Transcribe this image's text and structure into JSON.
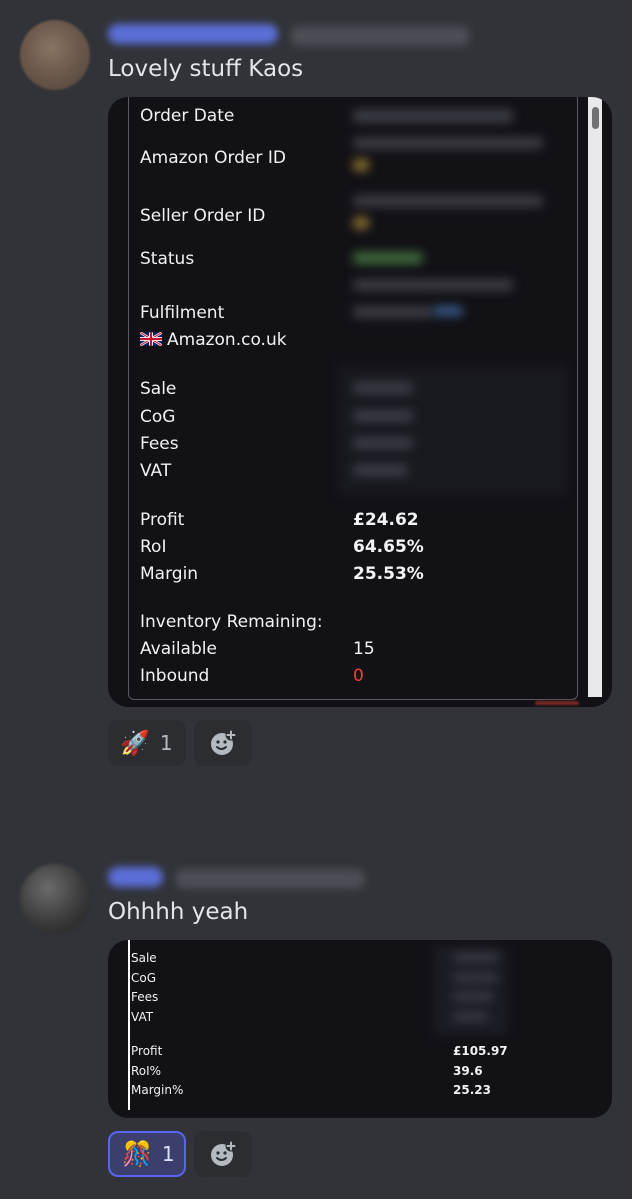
{
  "message1": {
    "text": "Lovely stuff Kaos",
    "card": {
      "order_date_label": "Order Date",
      "amazon_order_id_label": "Amazon Order ID",
      "seller_order_id_label": "Seller Order ID",
      "status_label": "Status",
      "fulfilment_label": "Fulfilment",
      "marketplace": "Amazon.co.uk",
      "sale_label": "Sale",
      "cog_label": "CoG",
      "fees_label": "Fees",
      "vat_label": "VAT",
      "profit_label": "Profit",
      "profit_value": "£24.62",
      "roi_label": "RoI",
      "roi_value": "64.65%",
      "margin_label": "Margin",
      "margin_value": "25.53%",
      "inventory_label": "Inventory Remaining:",
      "available_label": "Available",
      "available_value": "15",
      "inbound_label": "Inbound",
      "inbound_value": "0"
    },
    "reaction": {
      "emoji": "🚀",
      "count": "1"
    }
  },
  "message2": {
    "text": "Ohhhh yeah",
    "card": {
      "sale_label": "Sale",
      "cog_label": "CoG",
      "fees_label": "Fees",
      "vat_label": "VAT",
      "profit_label": "Profit",
      "profit_value": "£105.97",
      "roi_label": "RoI%",
      "roi_value": "39.6",
      "margin_label": "Margin%",
      "margin_value": "25.23"
    },
    "reaction": {
      "emoji": "🎊",
      "count": "1"
    }
  },
  "icons": {
    "add_reaction": "add-reaction-icon",
    "flag": "uk-flag-icon"
  },
  "colors": {
    "background": "#313338",
    "card": "#121116",
    "inbound_red": "#e8453c",
    "reaction_selected_border": "#5865f2"
  }
}
